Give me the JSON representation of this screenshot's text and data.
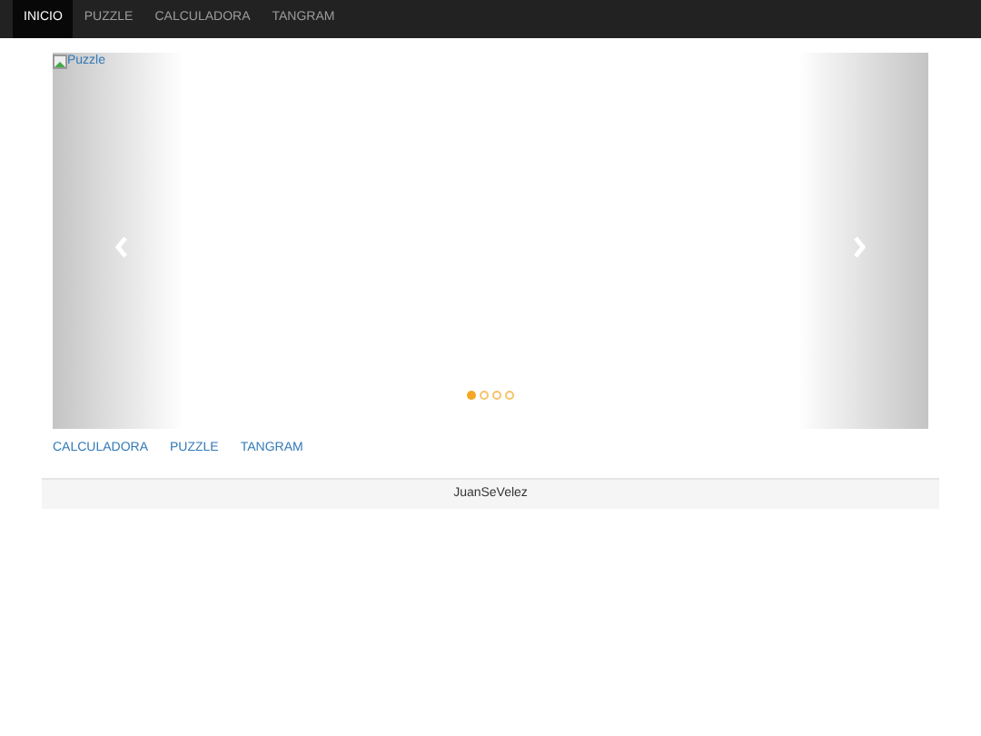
{
  "navbar": {
    "items": [
      {
        "label": "INICIO",
        "selected": true
      },
      {
        "label": "PUZZLE",
        "selected": false
      },
      {
        "label": "CALCULADORA",
        "selected": false
      },
      {
        "label": "TANGRAM",
        "selected": false
      }
    ]
  },
  "carousel": {
    "image_alt": "Puzzle",
    "indicators": [
      {
        "selected": true
      },
      {
        "selected": false
      },
      {
        "selected": false
      },
      {
        "selected": false
      }
    ]
  },
  "links": [
    "CALCULADORA",
    "PUZZLE",
    "TANGRAM"
  ],
  "footer": {
    "text": "JuanSeVelez"
  }
}
